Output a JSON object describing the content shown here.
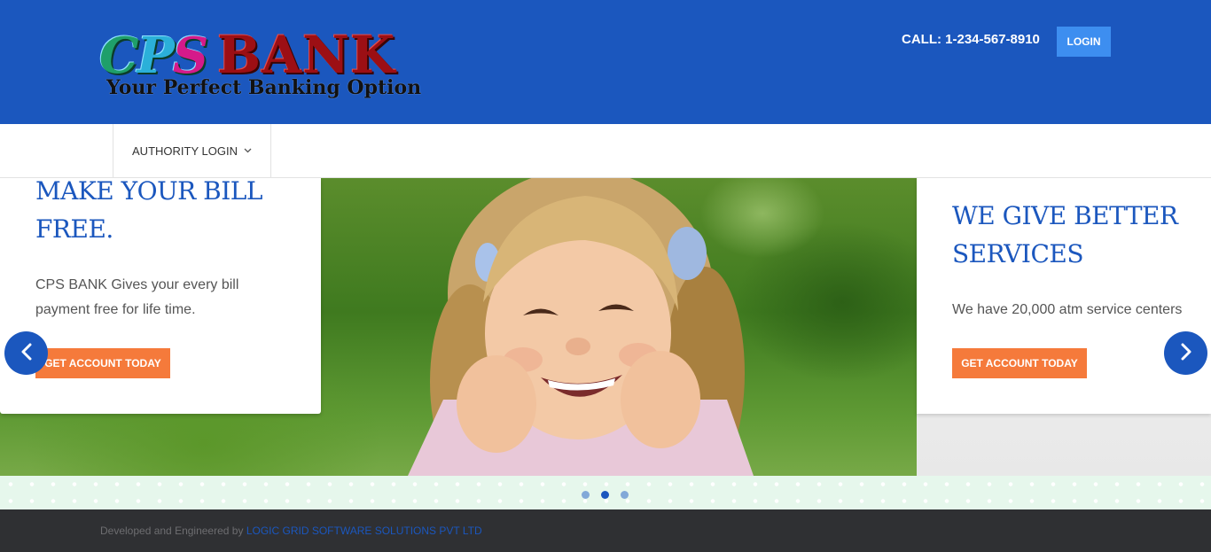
{
  "header": {
    "logo": {
      "brand_first": "CPS",
      "brand_second": "BANK",
      "tagline": "Your Perfect Banking Option"
    },
    "call_text": "CALL: 1-234-567-8910",
    "login_label": "LOGIN"
  },
  "nav": {
    "items": [
      {
        "label": "AUTHORITY LOGIN",
        "icon": "chevron-down-icon"
      }
    ]
  },
  "slider": {
    "slides": [
      {
        "title": "MAKE YOUR BILL FREE.",
        "text": "CPS BANK Gives your every bill payment free for life time.",
        "cta": "GET ACCOUNT TODAY"
      },
      {
        "title": "WE GIVE BETTER SERVICES",
        "text": "We have 20,000 atm service centers",
        "cta": "GET ACCOUNT TODAY"
      }
    ],
    "dots": 3,
    "active_dot": 2
  },
  "footer": {
    "prefix": "Developed and Engineered by",
    "company": "LOGIC GRID SOFTWARE SOLUTIONS PVT LTD"
  },
  "colors": {
    "primary": "#1b57be",
    "accent": "#f57a3b",
    "login_button": "#3d8ef0",
    "footer_bg": "#2f3033"
  }
}
